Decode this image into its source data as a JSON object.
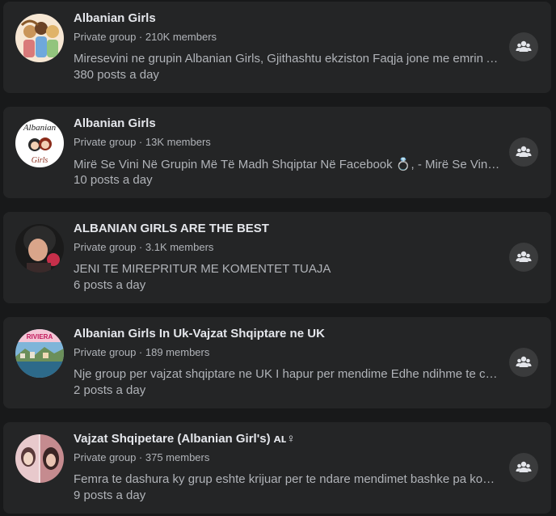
{
  "groups": [
    {
      "name": "Albanian Girls",
      "meta": "Private group · 210K members",
      "description": "Miresevini ne grupin Albanian Girls, Gjithashtu ekziston Faqja jone me emrin Albanian Girls",
      "activity": "380 posts a day",
      "avatar_icon": "illustrated-girls-avatar",
      "avatar_colors": [
        "#f7e7d4",
        "#c9955a",
        "#6b4226"
      ]
    },
    {
      "name": "Albanian Girls",
      "meta": "Private group · 13K members",
      "description": "Mirë Se Vini Në Grupin Më Të Madh Shqiptar Në Facebook 💍, - Mirë Se Vini Në Grupin Më Të Madh",
      "activity": "10 posts a day",
      "avatar_icon": "albanian-girls-logo-avatar",
      "avatar_text_top": "Albanian",
      "avatar_text_bottom": "Girls",
      "avatar_colors": [
        "#ffffff",
        "#8b2c1a",
        "#222222"
      ]
    },
    {
      "name": "ALBANIAN GIRLS ARE THE BEST",
      "meta": "Private group · 3.1K members",
      "description": "JENI TE MIREPRITUR ME KOMENTET TUAJA",
      "activity": "6 posts a day",
      "avatar_icon": "portrait-photo-avatar",
      "avatar_colors": [
        "#1a1a1a",
        "#d9a58a",
        "#c62f4a"
      ]
    },
    {
      "name": "Albanian Girls In Uk-Vajzat Shqiptare ne UK",
      "meta": "Private group · 189 members",
      "description": "Nje group per vajzat shqiptare ne UK I hapur per mendime Edhe ndihme te cdo lloji",
      "activity": "2 posts a day",
      "avatar_icon": "riviera-landscape-avatar",
      "avatar_text_top": "RIVIERA",
      "avatar_colors": [
        "#7fb5d9",
        "#e9e2d0",
        "#2d6a8a"
      ]
    },
    {
      "name": "Vajzat Shqipetare (Albanian Girl's) ᴀʟ♀",
      "meta": "Private group · 375 members",
      "description": "Femra te dashura ky grup eshte krijuar per te ndare mendimet bashke pa komplekse",
      "activity": "9 posts a day",
      "avatar_icon": "two-portraits-avatar",
      "avatar_colors": [
        "#e8c9cc",
        "#5a3a3a",
        "#c58b8f"
      ]
    }
  ],
  "join_icon": "group-members-icon"
}
